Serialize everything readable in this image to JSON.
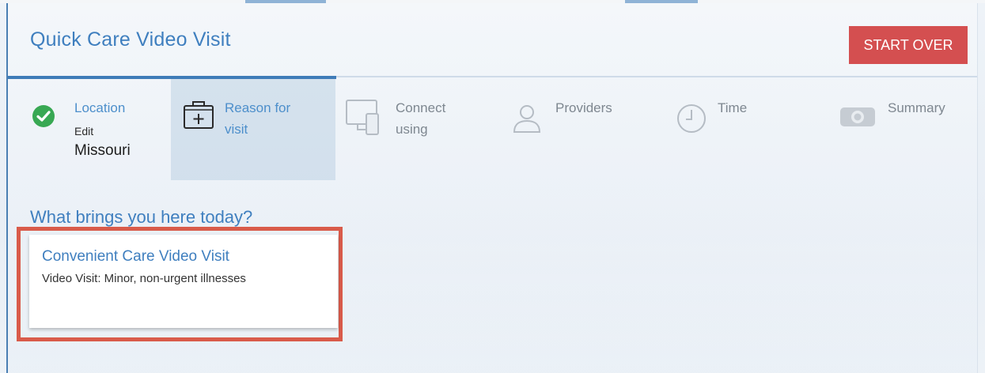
{
  "header": {
    "title": "Quick Care Video Visit",
    "start_over_label": "START OVER"
  },
  "steps": [
    {
      "id": "location",
      "label": "Location",
      "status": "complete",
      "edit_label": "Edit",
      "value": "Missouri",
      "icon": "check-circle-icon"
    },
    {
      "id": "reason",
      "label_line1": "Reason for",
      "label_line2": "visit",
      "status": "active",
      "icon": "medical-kit-icon"
    },
    {
      "id": "connect",
      "label_line1": "Connect",
      "label_line2": "using",
      "status": "pending",
      "icon": "devices-icon"
    },
    {
      "id": "providers",
      "label": "Providers",
      "status": "pending",
      "icon": "person-icon"
    },
    {
      "id": "time",
      "label": "Time",
      "status": "pending",
      "icon": "clock-icon"
    },
    {
      "id": "summary",
      "label": "Summary",
      "status": "pending",
      "icon": "camera-icon"
    }
  ],
  "main": {
    "question": "What brings you here today?",
    "options": [
      {
        "title": "Convenient Care Video Visit",
        "description": "Video Visit: Minor, non-urgent illnesses"
      }
    ]
  },
  "colors": {
    "brand_blue": "#3f7fbf",
    "start_over_red": "#d44f50",
    "highlight_red": "#d95b4a",
    "check_green": "#38a853"
  }
}
